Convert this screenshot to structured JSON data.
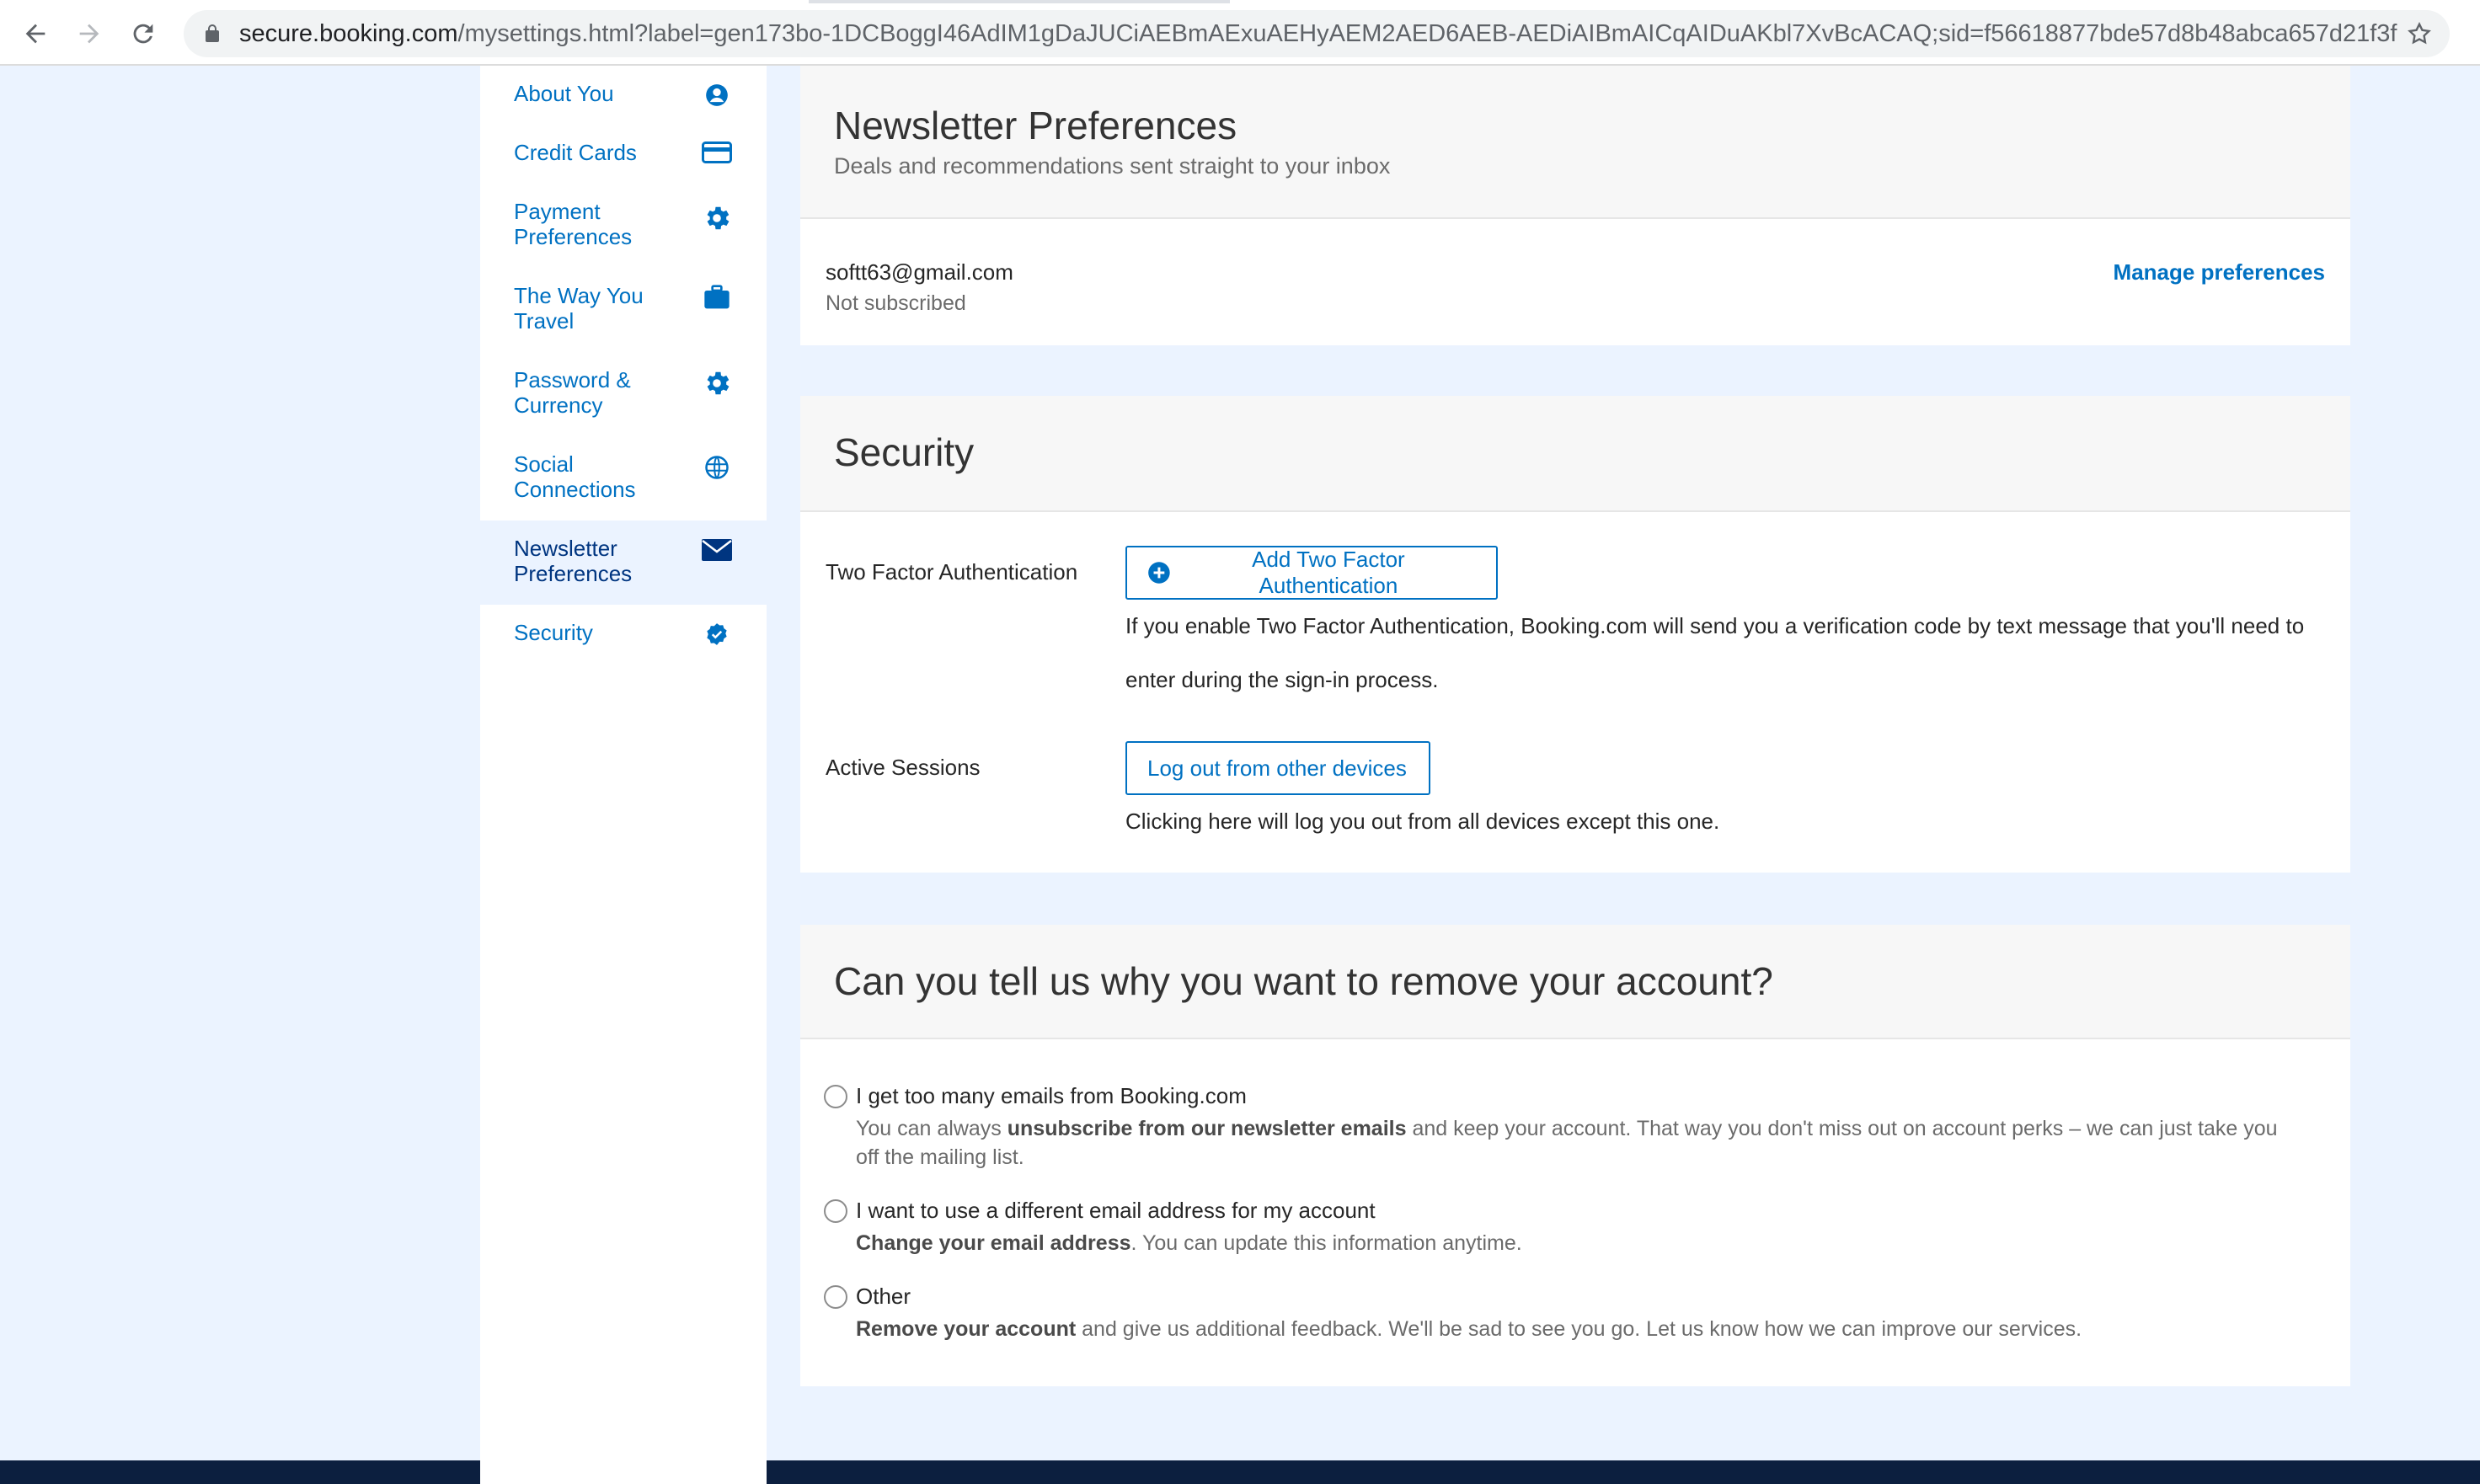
{
  "browser": {
    "url_host": "secure.booking.com",
    "url_path": "/mysettings.html?label=gen173bo-1DCBoggI46AdIM1gDaJUCiAEBmAExuAEHyAEM2AED6AEB-AEDiAIBmAICqAIDuAKbl7XvBcACAQ;sid=f56618877bde57d8b48abca657d21f3f"
  },
  "sidebar": {
    "items": [
      {
        "label": "About You",
        "icon": "user-circle-icon"
      },
      {
        "label": "Credit Cards",
        "icon": "credit-card-icon"
      },
      {
        "label": "Payment Preferences",
        "icon": "gear-icon"
      },
      {
        "label": "The Way You Travel",
        "icon": "suitcase-icon"
      },
      {
        "label": "Password & Currency",
        "icon": "gear-icon"
      },
      {
        "label": "Social Connections",
        "icon": "globe-icon"
      },
      {
        "label": "Newsletter Preferences",
        "icon": "envelope-icon"
      },
      {
        "label": "Security",
        "icon": "checkmark-badge-icon"
      }
    ],
    "active_index": 6
  },
  "newsletter": {
    "title": "Newsletter Preferences",
    "subtitle": "Deals and recommendations sent straight to your inbox",
    "email": "softt63@gmail.com",
    "status": "Not subscribed",
    "manage_link": "Manage preferences"
  },
  "security": {
    "title": "Security",
    "two_factor_label": "Two Factor Authentication",
    "two_factor_button": "Add Two Factor Authentication",
    "two_factor_desc_line1": "If you enable Two Factor Authentication, Booking.com will send you a verification code by text message that you'll need to",
    "two_factor_desc_line2": "enter during the sign-in process.",
    "sessions_label": "Active Sessions",
    "sessions_button": "Log out from other devices",
    "sessions_desc": "Clicking here will log you out from all devices except this one."
  },
  "remove_account": {
    "title": "Can you tell us why you want to remove your account?",
    "options": [
      {
        "label": "I get too many emails from Booking.com",
        "desc_pre": "You can always ",
        "desc_bold": "unsubscribe from our newsletter emails",
        "desc_post_line1": " and keep your account. That way you don't miss out on account perks – we can just take you",
        "desc_line2": "off the mailing list."
      },
      {
        "label": "I want to use a different email address for my account",
        "desc_bold": "Change your email address",
        "desc_post": ". You can update this information anytime."
      },
      {
        "label": "Other",
        "desc_bold": "Remove your account",
        "desc_post": " and give us additional feedback. We'll be sad to see you go. Let us know how we can improve our services."
      }
    ]
  },
  "colors": {
    "brand_blue": "#0071c2",
    "dark_blue": "#003580",
    "page_bg": "#ebf3ff",
    "footer": "#0c1f3f"
  }
}
